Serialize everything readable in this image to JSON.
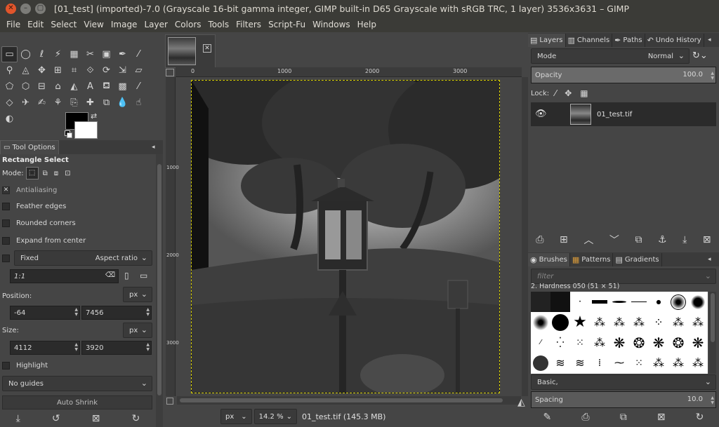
{
  "window": {
    "title": "[01_test] (imported)-7.0 (Grayscale 16-bit gamma integer, GIMP built-in D65 Grayscale with sRGB TRC, 1 layer) 3536x3631 – GIMP"
  },
  "menubar": {
    "items": [
      "File",
      "Edit",
      "Select",
      "View",
      "Image",
      "Layer",
      "Colors",
      "Tools",
      "Filters",
      "Script-Fu",
      "Windows",
      "Help"
    ]
  },
  "toolbox": {
    "tools": [
      {
        "name": "rect-select-icon",
        "glyph": "▭"
      },
      {
        "name": "ellipse-select-icon",
        "glyph": "◯"
      },
      {
        "name": "free-select-icon",
        "glyph": "ℓ"
      },
      {
        "name": "fuzzy-select-icon",
        "glyph": "⚡"
      },
      {
        "name": "by-color-select-icon",
        "glyph": "▦"
      },
      {
        "name": "scissors-icon",
        "glyph": "✂"
      },
      {
        "name": "foreground-select-icon",
        "glyph": "▣"
      },
      {
        "name": "paths-icon",
        "glyph": "✒"
      },
      {
        "name": "color-picker-icon",
        "glyph": "⁄"
      },
      {
        "name": "zoom-icon",
        "glyph": "⚲"
      },
      {
        "name": "measure-icon",
        "glyph": "◬"
      },
      {
        "name": "move-icon",
        "glyph": "✥"
      },
      {
        "name": "alignment-icon",
        "glyph": "⊞"
      },
      {
        "name": "crop-icon",
        "glyph": "⌗"
      },
      {
        "name": "unified-transform-icon",
        "glyph": "⟐"
      },
      {
        "name": "rotate-icon",
        "glyph": "⟳"
      },
      {
        "name": "scale-icon",
        "glyph": "⇲"
      },
      {
        "name": "shear-icon",
        "glyph": "▱"
      },
      {
        "name": "perspective-icon",
        "glyph": "⬠"
      },
      {
        "name": "3d-transform-icon",
        "glyph": "⬡"
      },
      {
        "name": "warp-transform-icon",
        "glyph": "⊟"
      },
      {
        "name": "cage-transform-icon",
        "glyph": "⌂"
      },
      {
        "name": "flip-icon",
        "glyph": "◭"
      },
      {
        "name": "text-icon",
        "glyph": "A"
      },
      {
        "name": "bucket-fill-icon",
        "glyph": "⛾"
      },
      {
        "name": "gradient-icon",
        "glyph": "▩"
      },
      {
        "name": "paintbrush-icon",
        "glyph": "⁄"
      },
      {
        "name": "eraser-icon",
        "glyph": "◇"
      },
      {
        "name": "airbrush-icon",
        "glyph": "✈"
      },
      {
        "name": "ink-icon",
        "glyph": "✍"
      },
      {
        "name": "mypaint-brush-icon",
        "glyph": "⚘"
      },
      {
        "name": "clone-icon",
        "glyph": "⎘"
      },
      {
        "name": "heal-icon",
        "glyph": "✚"
      },
      {
        "name": "perspective-clone-icon",
        "glyph": "⧉"
      },
      {
        "name": "blur-icon",
        "glyph": "💧"
      },
      {
        "name": "smudge-icon",
        "glyph": "☝"
      },
      {
        "name": "dodge-burn-icon",
        "glyph": "◐"
      }
    ]
  },
  "tool_options": {
    "tab_label": "Tool Options",
    "heading": "Rectangle Select",
    "mode_label": "Mode:",
    "antialiasing": "Antialiasing",
    "feather_edges": "Feather edges",
    "rounded_corners": "Rounded corners",
    "expand_from_center": "Expand from center",
    "fixed_label": "Fixed",
    "fixed_mode": "Aspect ratio",
    "ratio_value": "1:1",
    "position_label": "Position:",
    "position_unit": "px",
    "position_x": "-64",
    "position_y": "7456",
    "size_label": "Size:",
    "size_unit": "px",
    "size_w": "4112",
    "size_h": "3920",
    "highlight": "Highlight",
    "guides": "No guides",
    "auto_shrink": "Auto Shrink"
  },
  "canvas": {
    "ruler_labels": [
      "0",
      "1000",
      "2000",
      "3000"
    ],
    "vruler_labels": [
      "1000",
      "2000",
      "3000"
    ],
    "unit": "px",
    "zoom": "14.2 %",
    "status": "01_test.tif (145.3 MB)"
  },
  "layers_dock": {
    "tabs": [
      "Layers",
      "Channels",
      "Paths",
      "Undo History"
    ],
    "mode_label": "Mode",
    "mode_value": "Normal",
    "opacity_label": "Opacity",
    "opacity_value": "100.0",
    "opacity_fraction": 1.0,
    "lock_label": "Lock:",
    "layer_name": "01_test.tif"
  },
  "brushes_dock": {
    "tabs": [
      "Brushes",
      "Patterns",
      "Gradients"
    ],
    "filter_placeholder": "filter",
    "brush_name": "2. Hardness 050 (51 × 51)",
    "preset": "Basic,",
    "spacing_label": "Spacing",
    "spacing_value": "10.0"
  },
  "colors": {
    "accent_selection": "#d8d000",
    "foreground": "#000000",
    "background": "#ffffff"
  }
}
